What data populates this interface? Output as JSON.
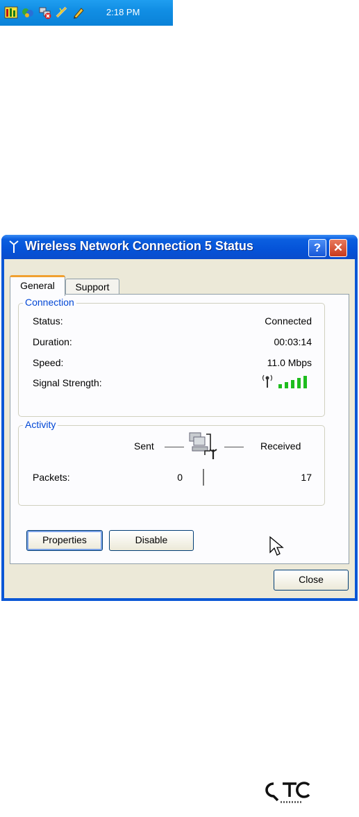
{
  "tray": {
    "icons": [
      "network-monitor-icon",
      "msn-messenger-icon",
      "network-disconnected-icon",
      "wireless-network-icon",
      "pencil-tool-icon"
    ],
    "clock": "2:18 PM"
  },
  "dialog": {
    "title": "Wireless Network Connection 5 Status",
    "title_icon": "antenna-icon",
    "help_label": "?",
    "close_label": "✕",
    "tabs": [
      {
        "label": "General",
        "active": true
      },
      {
        "label": "Support",
        "active": false
      }
    ],
    "connection": {
      "legend": "Connection",
      "rows": [
        {
          "label": "Status:",
          "value": "Connected"
        },
        {
          "label": "Duration:",
          "value": "00:03:14"
        },
        {
          "label": "Speed:",
          "value": "11.0 Mbps"
        },
        {
          "label": "Signal Strength:",
          "value": ""
        }
      ],
      "signal_bars_total": 5,
      "signal_bars_filled": 5
    },
    "activity": {
      "legend": "Activity",
      "sent_label": "Sent",
      "received_label": "Received",
      "packets_label": "Packets:",
      "packets_sent": "0",
      "packets_received": "17"
    },
    "buttons": {
      "properties": "Properties",
      "disable": "Disable",
      "close": "Close"
    }
  },
  "logo": {
    "name": "QTC",
    "tagline": "WIRELESS"
  },
  "colors": {
    "title_bar": "#0553d8",
    "legend_text": "#0046d5",
    "signal_green": "#1dbd1d"
  }
}
